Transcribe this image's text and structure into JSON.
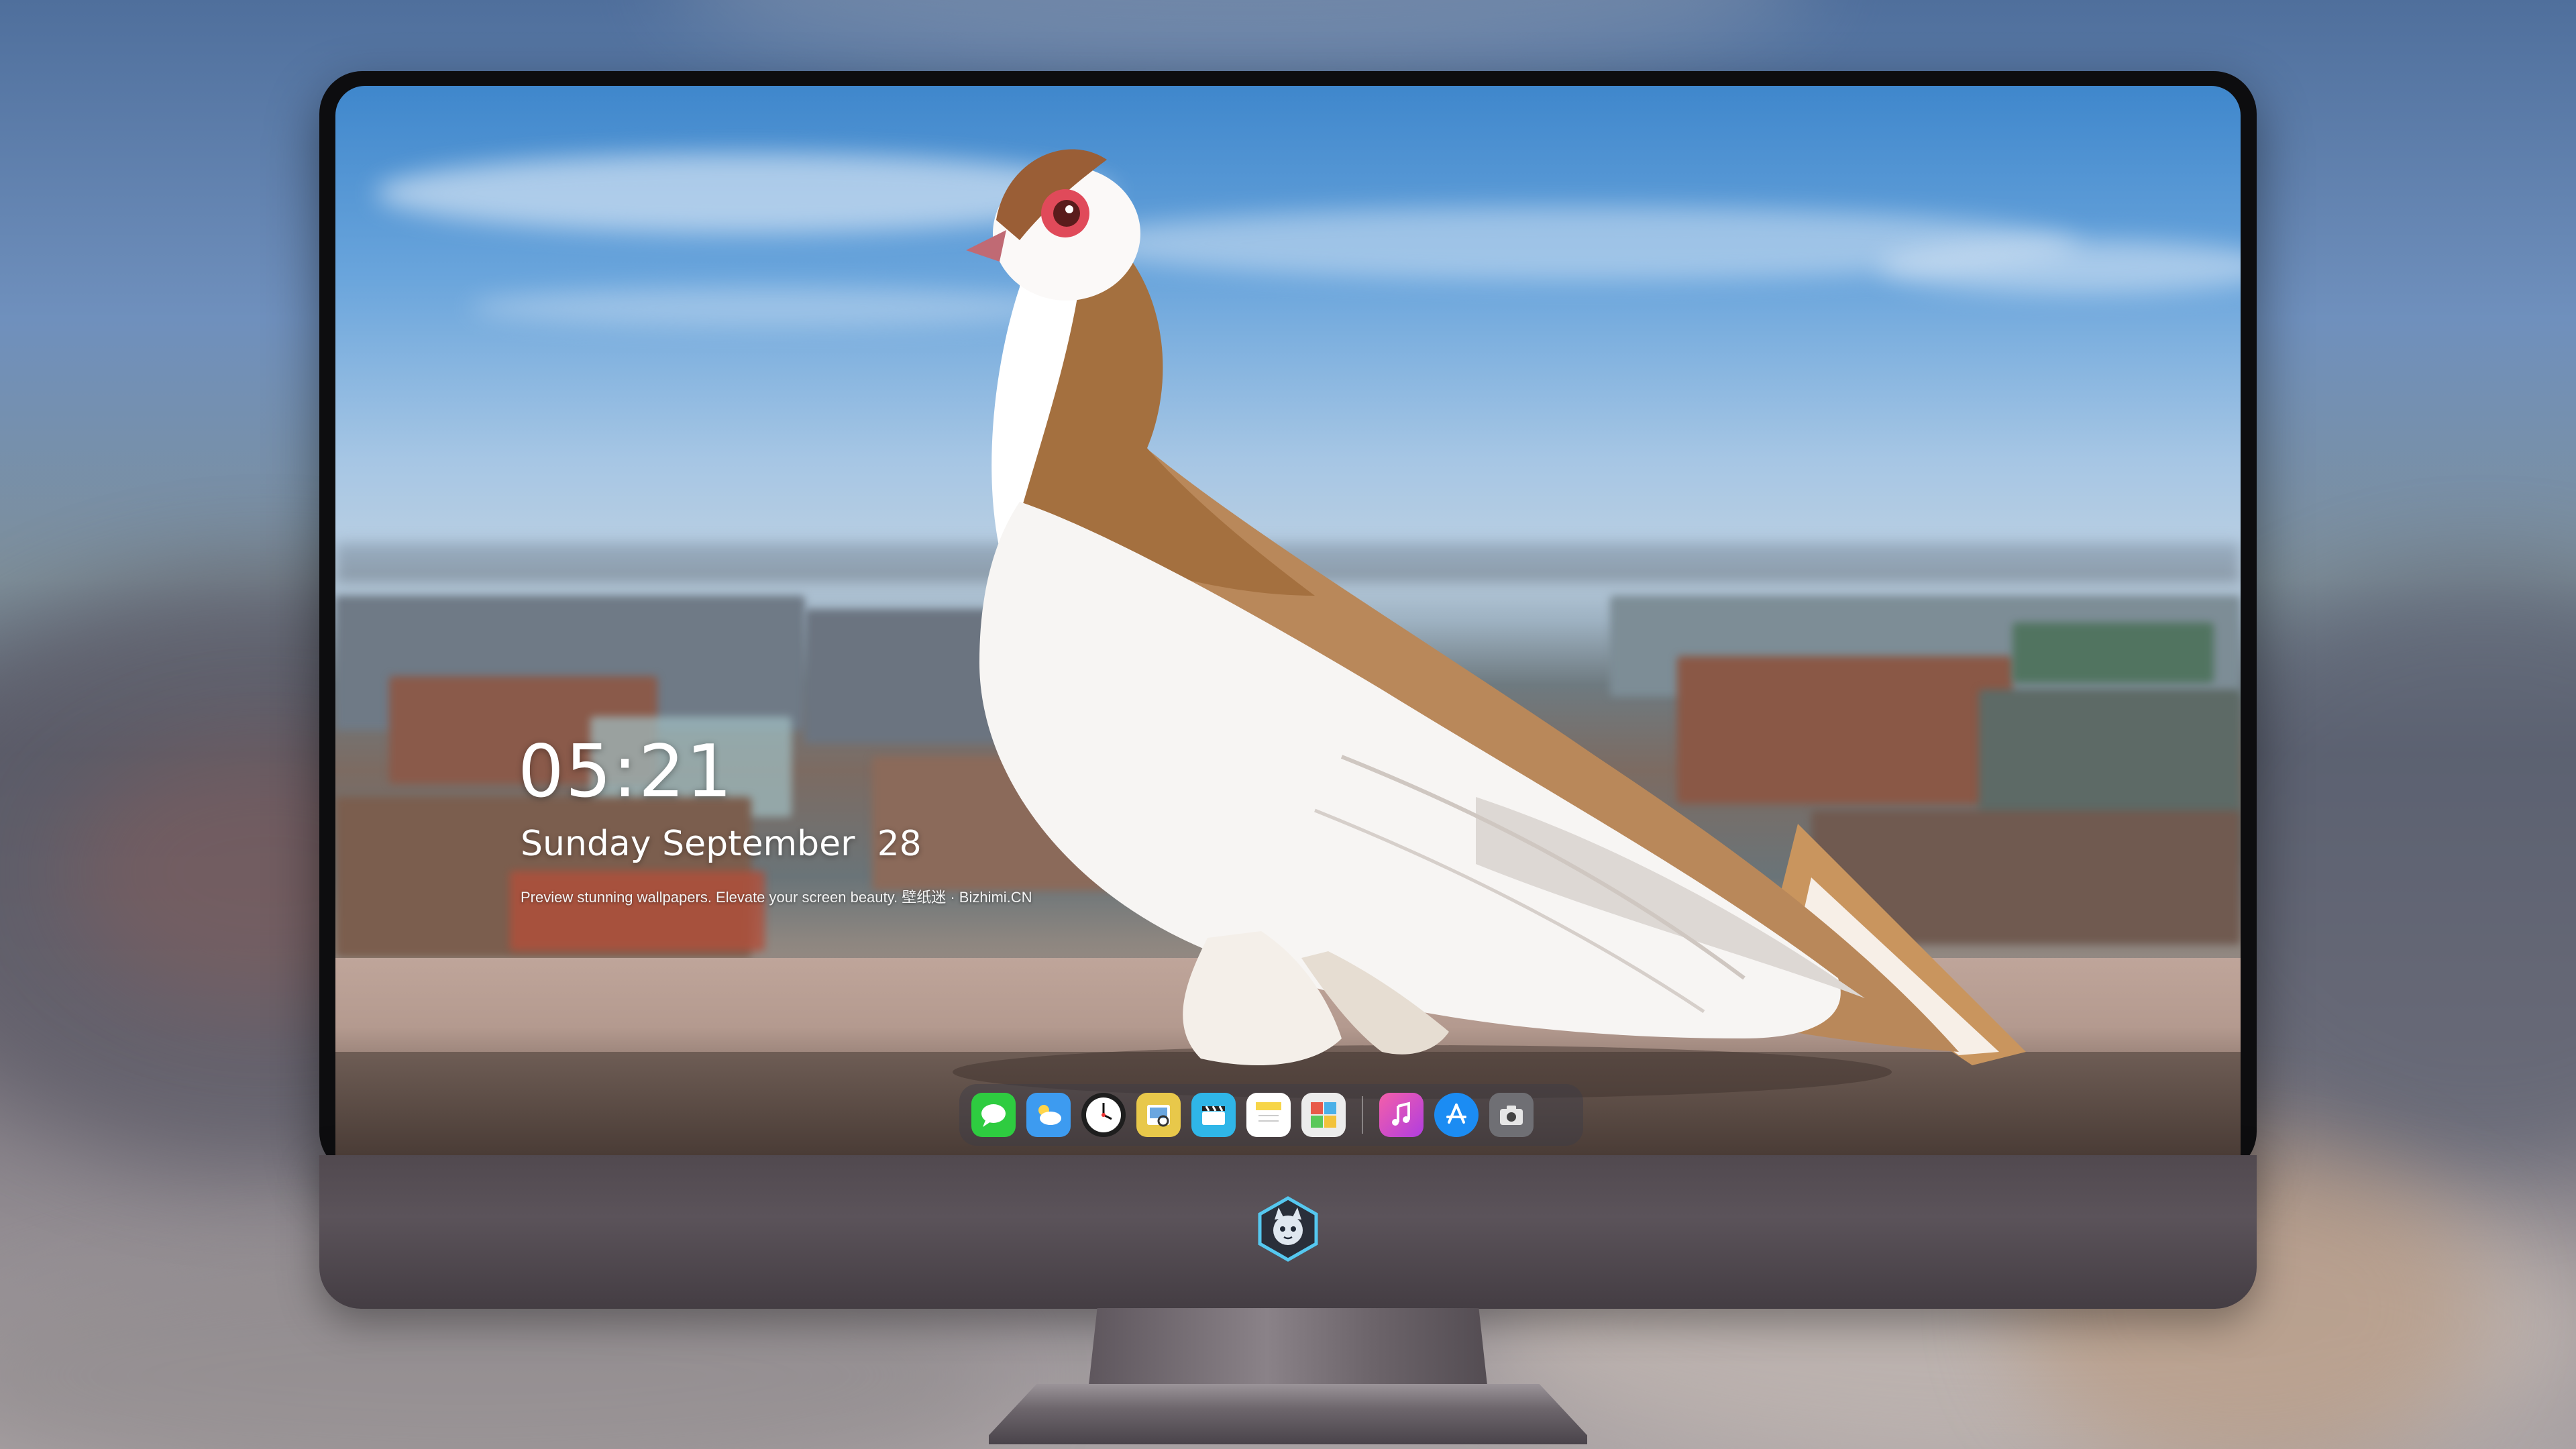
{
  "lockscreen": {
    "time": "05:21",
    "date": "Sunday September  28",
    "tagline": "Preview stunning wallpapers. Elevate your screen beauty. 壁纸迷 · Bizhimi.CN"
  },
  "dock": {
    "items": [
      {
        "name": "messages",
        "icon": "messages-icon",
        "color": "#2ecc40"
      },
      {
        "name": "weather",
        "icon": "weather-icon",
        "color": "#3d9bf0"
      },
      {
        "name": "clock",
        "icon": "clock-icon",
        "color": "#ffffff"
      },
      {
        "name": "preview",
        "icon": "preview-icon",
        "color": "#e8c84a"
      },
      {
        "name": "clips",
        "icon": "clips-icon",
        "color": "#2fb6e8"
      },
      {
        "name": "notes",
        "icon": "notes-icon",
        "color": "#f7d548"
      },
      {
        "name": "photo-booth",
        "icon": "photo-booth-icon",
        "color": "#e85a4a"
      },
      {
        "name": "music",
        "icon": "music-icon",
        "color": "#e44bd6"
      },
      {
        "name": "app-store",
        "icon": "app-store-icon",
        "color": "#1b8cf3"
      },
      {
        "name": "camera",
        "icon": "camera-icon",
        "color": "#6f6f74"
      }
    ]
  },
  "monitor": {
    "logo": "mascot-logo-icon",
    "bezel_color": "#0d0d0f",
    "chin_color": "#554d53"
  }
}
